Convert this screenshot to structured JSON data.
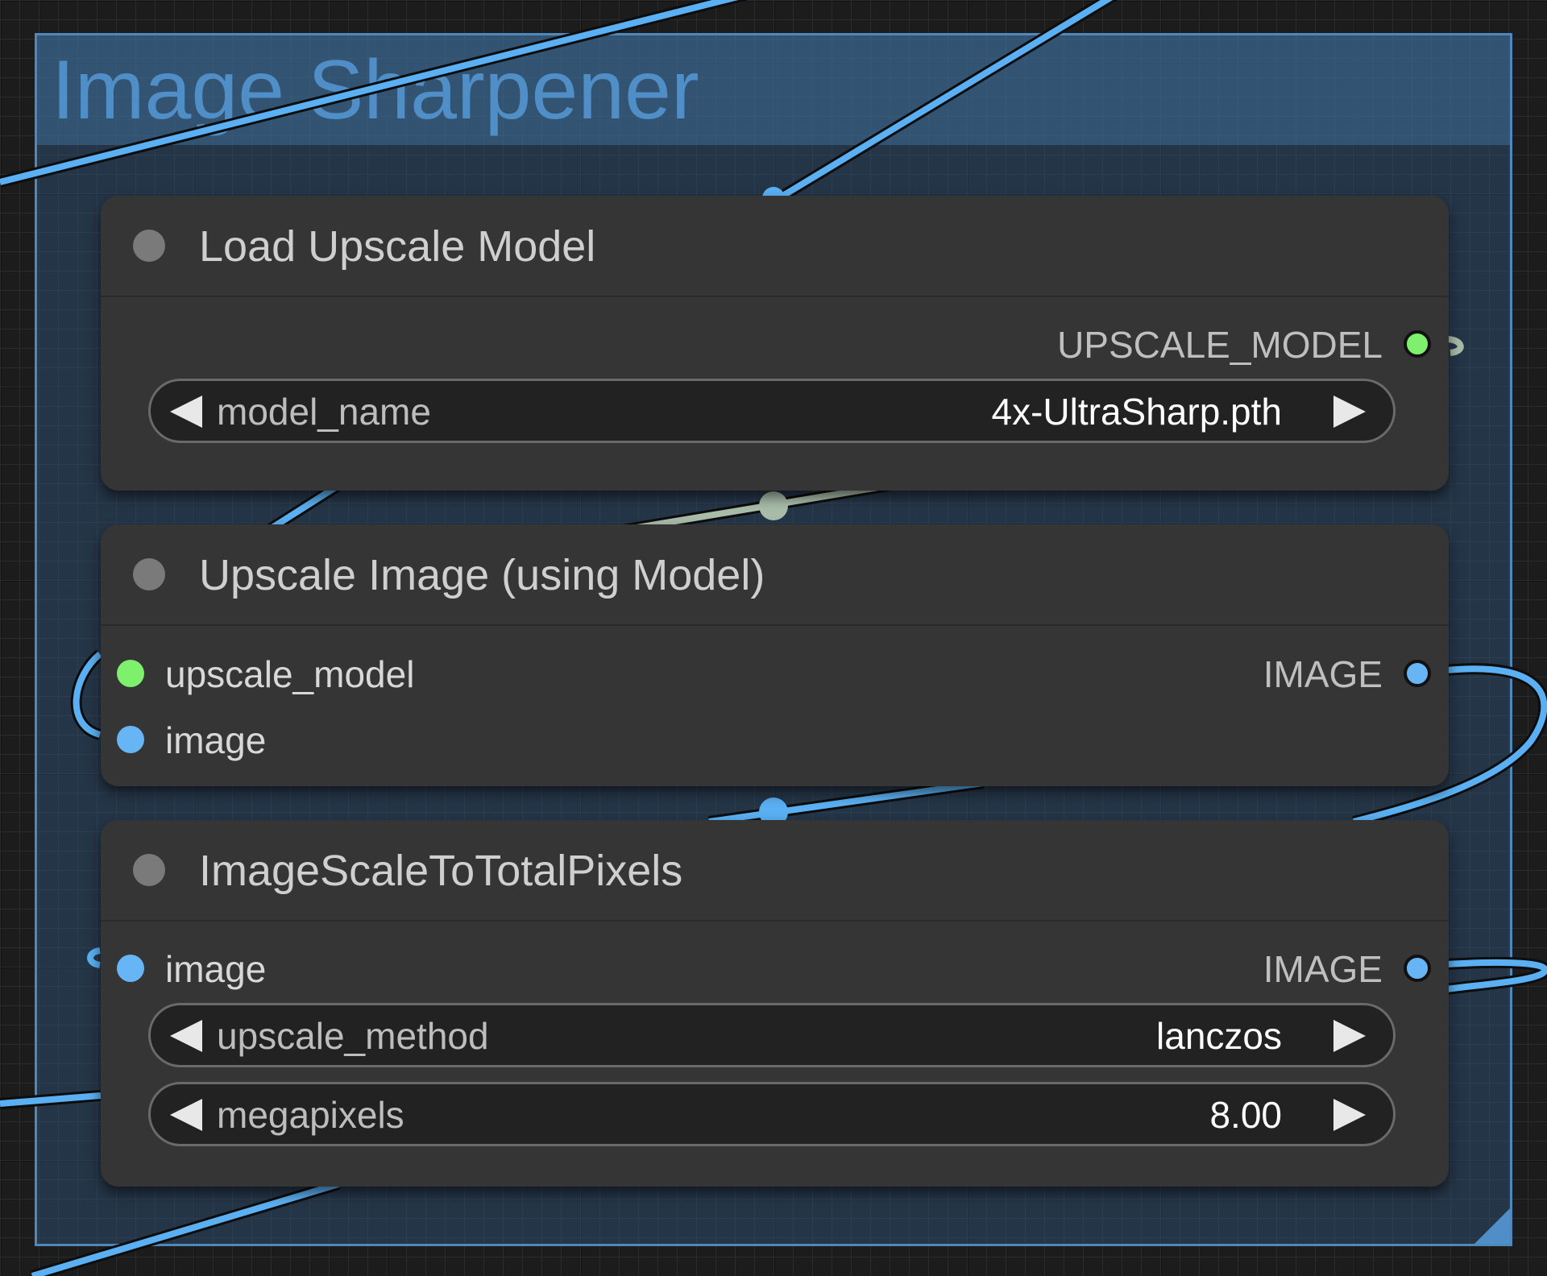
{
  "group": {
    "title": "Image Sharpener",
    "color": "#4f88bd"
  },
  "colors": {
    "upscale_model_slot": "#7ff06e",
    "image_slot": "#67b5f5",
    "image_wire": "#5ab0f2",
    "model_wire": "#a9bca9"
  },
  "nodes": [
    {
      "title": "Load Upscale Model",
      "outputs": [
        {
          "label": "UPSCALE_MODEL",
          "type": "upscale_model"
        }
      ],
      "widgets": [
        {
          "label": "model_name",
          "value": "4x-UltraSharp.pth"
        }
      ]
    },
    {
      "title": "Upscale Image (using Model)",
      "inputs": [
        {
          "label": "upscale_model",
          "type": "upscale_model"
        },
        {
          "label": "image",
          "type": "image"
        }
      ],
      "outputs": [
        {
          "label": "IMAGE",
          "type": "image"
        }
      ]
    },
    {
      "title": "ImageScaleToTotalPixels",
      "inputs": [
        {
          "label": "image",
          "type": "image"
        }
      ],
      "outputs": [
        {
          "label": "IMAGE",
          "type": "image"
        }
      ],
      "widgets": [
        {
          "label": "upscale_method",
          "value": "lanczos"
        },
        {
          "label": "megapixels",
          "value": "8.00"
        }
      ]
    }
  ]
}
